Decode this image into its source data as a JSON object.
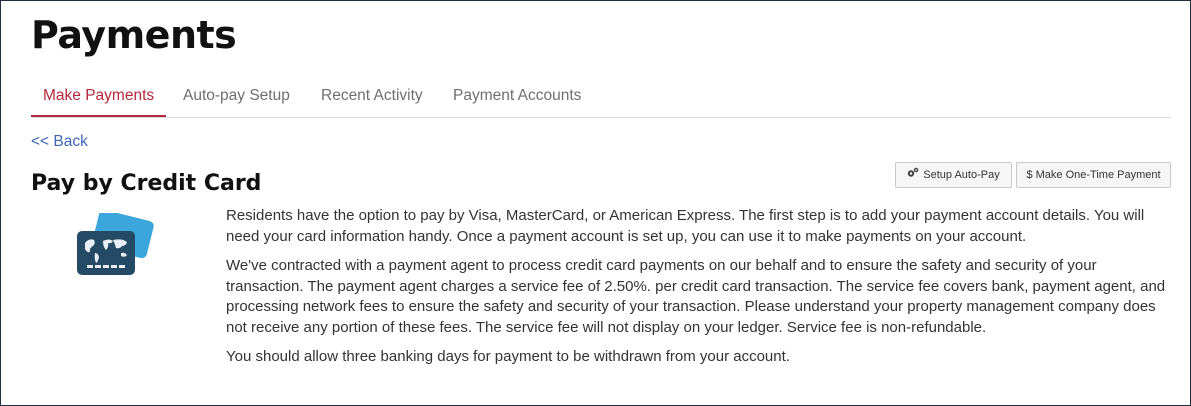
{
  "page": {
    "title": "Payments"
  },
  "tabs": [
    {
      "label": "Make Payments",
      "active": true
    },
    {
      "label": "Auto-pay Setup",
      "active": false
    },
    {
      "label": "Recent Activity",
      "active": false
    },
    {
      "label": "Payment Accounts",
      "active": false
    }
  ],
  "nav": {
    "back_label": "<< Back"
  },
  "section": {
    "title": "Pay by Credit Card",
    "icon": "credit-card-world-map-icon"
  },
  "actions": {
    "setup_autopay_label": "Setup Auto-Pay",
    "setup_autopay_icon": "gears-icon",
    "one_time_label": "$ Make One-Time Payment"
  },
  "content": {
    "paragraph_1": "Residents have the option to pay by Visa, MasterCard, or American Express. The first step is to add your payment account details. You will need your card information handy. Once a payment account is set up, you can use it to make payments on your account.",
    "paragraph_2": "We've contracted with a payment agent to process credit card payments on our behalf and to ensure the safety and security of your transaction. The payment agent charges a service fee of 2.50%. per credit card transaction. The service fee covers bank, payment agent, and processing network fees to ensure the safety and security of your transaction. Please understand your property management company does not receive any portion of these fees. The service fee will not display on your ledger. Service fee is non-refundable.",
    "paragraph_3": "You should allow three banking days for payment to be withdrawn from your account."
  },
  "colors": {
    "accent_active_tab": "#b4283d",
    "link": "#3f67b5",
    "card_front": "#244a66",
    "card_back": "#3aa6dc"
  }
}
